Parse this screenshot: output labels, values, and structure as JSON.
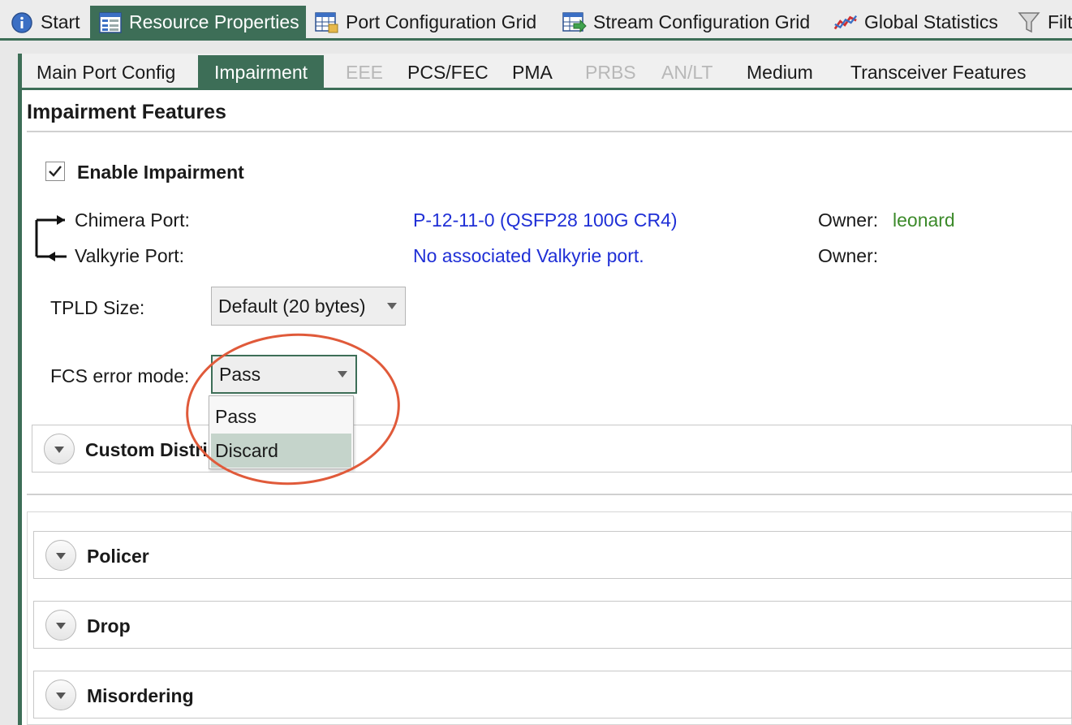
{
  "top_tabs": {
    "start": "Start",
    "resource_properties": "Resource Properties",
    "port_config_grid": "Port Configuration Grid",
    "stream_config_grid": "Stream Configuration Grid",
    "global_statistics": "Global Statistics",
    "filters": "Filt"
  },
  "sub_tabs": {
    "main_port_config": "Main Port Config",
    "impairment": "Impairment",
    "eee": "EEE",
    "pcs_fec": "PCS/FEC",
    "pma": "PMA",
    "prbs": "PRBS",
    "an_lt": "AN/LT",
    "medium": "Medium",
    "transceiver_features": "Transceiver Features"
  },
  "impairment": {
    "title": "Impairment Features",
    "enable_label": "Enable Impairment",
    "enabled": true,
    "chimera_label": "Chimera Port:",
    "chimera_value": "P-12-11-0 (QSFP28 100G CR4)",
    "chimera_owner_label": "Owner:",
    "chimera_owner_value": "leonard",
    "valkyrie_label": "Valkyrie Port:",
    "valkyrie_value": "No associated Valkyrie port.",
    "valkyrie_owner_label": "Owner:",
    "tpld_label": "TPLD Size:",
    "tpld_value": "Default (20 bytes)",
    "fcs_label": "FCS error mode:",
    "fcs_value": "Pass",
    "fcs_options": [
      "Pass",
      "Discard"
    ],
    "fcs_highlighted": "Discard"
  },
  "panels": {
    "custom_distributions": "Custom Distri",
    "policer": "Policer",
    "drop": "Drop",
    "misordering": "Misordering"
  },
  "colors": {
    "accent": "#3d6e57",
    "link": "#1f2fd6",
    "owner": "#3c8a2a",
    "annotation": "#e05a3a"
  }
}
